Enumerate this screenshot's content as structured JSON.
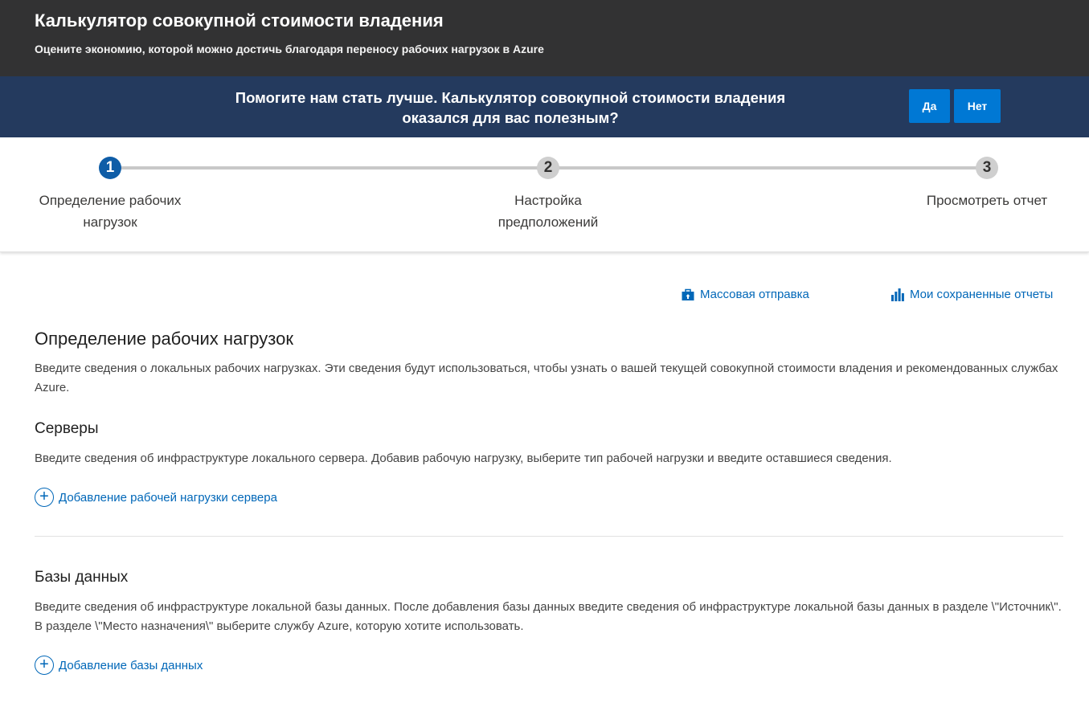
{
  "header": {
    "title": "Калькулятор совокупной стоимости владения",
    "subtitle": "Оцените экономию, которой можно достичь благодаря переносу рабочих нагрузок в Azure"
  },
  "banner": {
    "line1": "Помогите нам стать лучше. Калькулятор совокупной стоимости владения",
    "line2": "оказался для вас полезным?",
    "yes_label": "Да",
    "no_label": "Нет"
  },
  "stepper": {
    "steps": [
      {
        "number": "1",
        "line1": "Определение рабочих",
        "line2": "нагрузок",
        "active": true
      },
      {
        "number": "2",
        "line1": "Настройка",
        "line2": "предположений",
        "active": false
      },
      {
        "number": "3",
        "line1": "Просмотреть отчет",
        "line2": "",
        "active": false
      }
    ]
  },
  "links": {
    "bulk_upload": "Массовая отправка",
    "saved_reports": "Мои сохраненные отчеты"
  },
  "main": {
    "title": "Определение рабочих нагрузок",
    "description": "Введите сведения о локальных рабочих нагрузках. Эти сведения будут использоваться, чтобы узнать о вашей текущей совокупной стоимости владения и рекомендованных службах Azure.",
    "servers": {
      "title": "Серверы",
      "description": "Введите сведения об инфраструктуре локального сервера. Добавив рабочую нагрузку, выберите тип рабочей нагрузки и введите оставшиеся сведения.",
      "add_label": "Добавление рабочей нагрузки сервера"
    },
    "databases": {
      "title": "Базы данных",
      "description": "Введите сведения об инфраструктуре локальной базы данных. После добавления базы данных введите сведения об инфраструктуре локальной базы данных в разделе \\\"Источник\\\". В разделе \\\"Место назначения\\\" выберите службу Azure, которую хотите использовать.",
      "add_label": "Добавление базы данных"
    }
  },
  "icons": {
    "bulk_upload": "briefcase-upload-icon",
    "saved_reports": "bar-chart-icon",
    "add": "plus-circle-icon"
  },
  "colors": {
    "header_bg": "#323233",
    "banner_bg": "#243a5e",
    "accent": "#0078d4",
    "link": "#0067b8",
    "step_active": "#0f5da7",
    "step_inactive": "#cfcfcf"
  }
}
